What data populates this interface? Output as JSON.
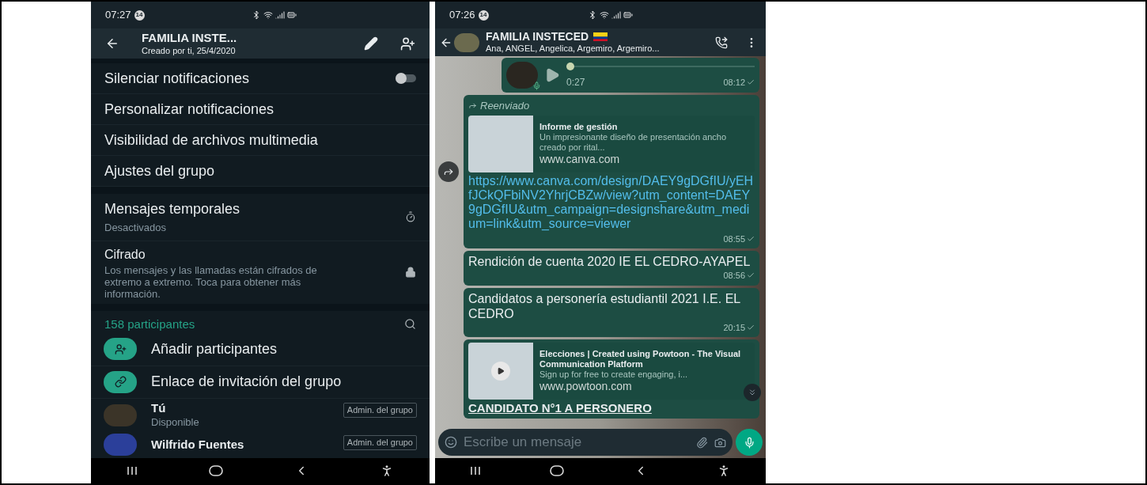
{
  "left_screen": {
    "status_bar": {
      "time": "07:27",
      "badge": "14"
    },
    "header": {
      "title": "FAMILIA INSTE...",
      "subtitle": "Creado por ti, 25/4/2020"
    },
    "settings": [
      {
        "kind": "toggle",
        "label": "Silenciar notificaciones",
        "on": false
      },
      {
        "kind": "plain",
        "label": "Personalizar notificaciones"
      },
      {
        "kind": "plain",
        "label": "Visibilidad de archivos multimedia"
      },
      {
        "kind": "plain",
        "label": "Ajustes del grupo"
      }
    ],
    "disappearing": {
      "title": "Mensajes temporales",
      "subtitle": "Desactivados"
    },
    "encryption": {
      "title": "Cifrado",
      "description": "Los mensajes y las llamadas están cifrados de extremo a extremo. Toca para obtener más información."
    },
    "participants": {
      "count": "158 participantes",
      "actions": [
        {
          "kind": "add",
          "label": "Añadir participantes"
        },
        {
          "kind": "link",
          "label": "Enlace de invitación del grupo"
        }
      ],
      "members": [
        {
          "name": "Tú",
          "status": "Disponible",
          "badge": "Admin. del grupo",
          "color": "#3b3428"
        },
        {
          "name": "Wilfrido Fuentes",
          "badge": "Admin. del grupo",
          "color": "#2b3f9a"
        }
      ]
    }
  },
  "right_screen": {
    "status_bar": {
      "time": "07:26",
      "badge": "14"
    },
    "header": {
      "title": "FAMILIA INSTECED",
      "subtitle": "Ana, ANGEL, Angelica, Argemiro, Argemiro..."
    },
    "messages": [
      {
        "kind": "voice",
        "duration": "0:27",
        "time": "08:12",
        "level": 0.0
      },
      {
        "kind": "link",
        "forwarded": "Reenviado",
        "preview_title": "Informe de gestión",
        "preview_description": "Un impresionante diseño de presentación ancho creado por rital...",
        "preview_domain": "www.canva.com",
        "url": "https://www.canva.com/design/DAEY9gDGfIU/yEHfJCkQFbiNV2YhrjCBZw/view?utm_content=DAEY9gDGfIU&utm_campaign=designshare&utm_medium=link&utm_source=viewer",
        "time": "08:55"
      },
      {
        "kind": "text",
        "text": "Rendición de cuenta 2020 IE EL CEDRO-AYAPEL",
        "time": "08:56"
      },
      {
        "kind": "text",
        "text": "Candidatos a personería estudiantil 2021 I.E. EL CEDRO",
        "time": "20:15"
      },
      {
        "kind": "video",
        "preview_title": "Elecciones | Created using Powtoon - The Visual Communication Platform",
        "preview_description": "Sign up for free to create engaging, i...",
        "preview_domain": "www.powtoon.com",
        "text": "CANDIDATO N°1 A PERSONERO"
      }
    ],
    "composer": {
      "placeholder": "Escribe un mensaje"
    }
  }
}
